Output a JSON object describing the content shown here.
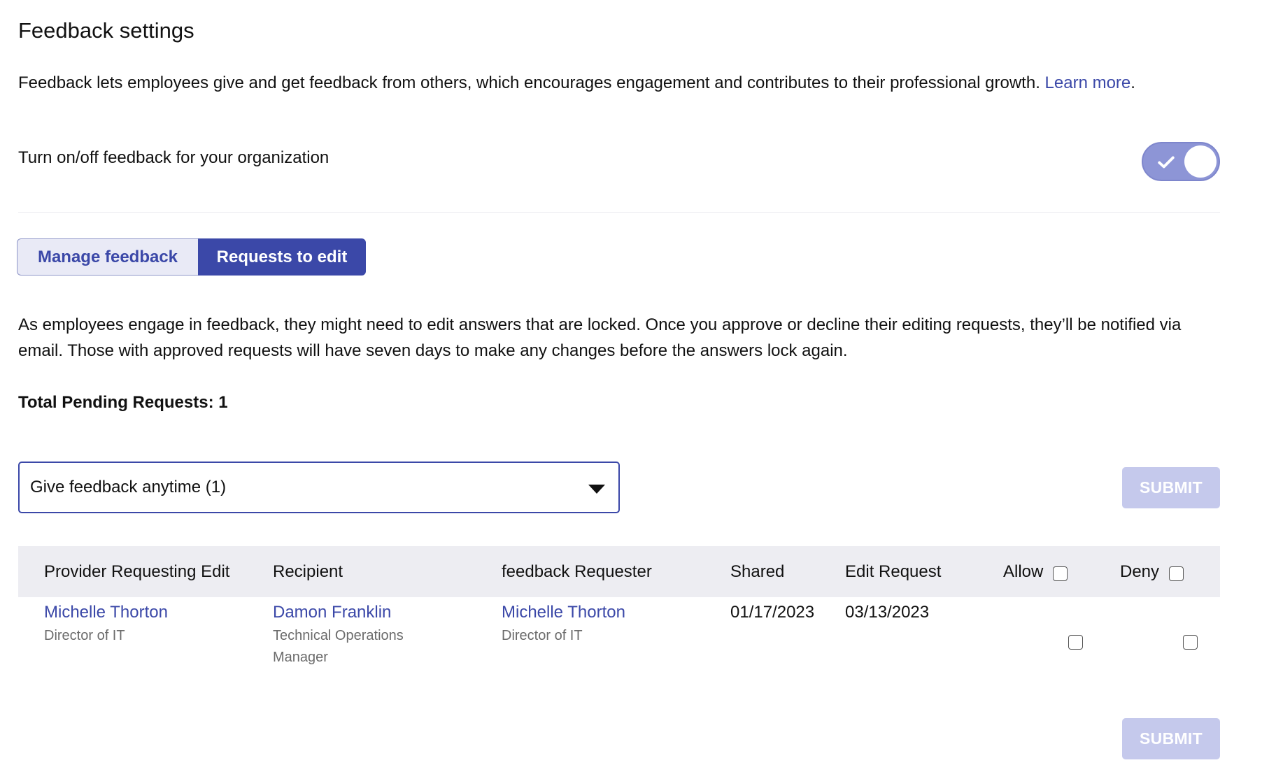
{
  "page": {
    "title": "Feedback settings",
    "intro_text": "Feedback lets employees give and get feedback from others, which encourages engagement and contributes to their professional growth. ",
    "intro_link": "Learn more",
    "intro_end": "."
  },
  "toggle": {
    "label": "Turn on/off feedback for your organization",
    "state": "on"
  },
  "tabs": [
    {
      "label": "Manage feedback",
      "active": false
    },
    {
      "label": "Requests to edit",
      "active": true
    }
  ],
  "requests": {
    "description": "As employees engage in feedback, they might need to edit answers that are locked. Once you approve or decline their editing requests, they’ll be notified via email. Those with approved requests will have seven days to make any changes before the answers lock again.",
    "pending_label": "Total Pending Requests: 1",
    "filter": {
      "selected": "Give feedback anytime (1)"
    },
    "submit_label": "SUBMIT"
  },
  "table": {
    "headers": {
      "provider": "Provider Requesting Edit",
      "recipient": "Recipient",
      "requester": "feedback Requester",
      "shared": "Shared",
      "edit_request": "Edit Request",
      "allow": "Allow",
      "deny": "Deny"
    },
    "rows": [
      {
        "provider_name": "Michelle Thorton",
        "provider_role": "Director of IT",
        "recipient_name": "Damon Franklin",
        "recipient_role": "Technical Operations Manager",
        "requester_name": "Michelle Thorton",
        "requester_role": "Director of IT",
        "shared": "01/17/2023",
        "edit_request": "03/13/2023",
        "allow": false,
        "deny": false
      }
    ]
  },
  "colors": {
    "accent": "#3b48a8",
    "toggle_on": "#8d95d6",
    "submit_disabled": "#c5c9ec",
    "header_bg": "#ededf2"
  }
}
